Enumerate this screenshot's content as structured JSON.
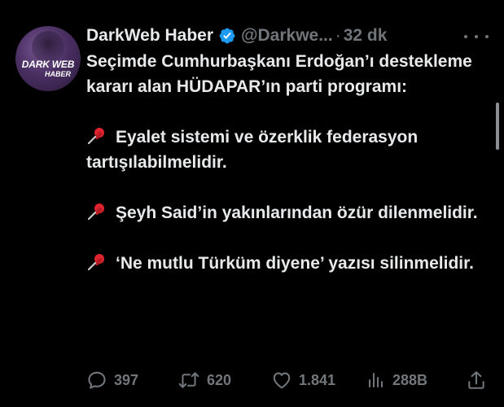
{
  "tweet": {
    "author": {
      "name": "DarkWeb Haber",
      "handle": "@Darkwe...",
      "verified": true,
      "avatar_logo_line1": "DARK WEB",
      "avatar_logo_line2": "HABER"
    },
    "separator": "·",
    "time": "32 dk",
    "text": {
      "intro": "Seçimde Cumhurbaşkanı Erdoğan’ı destekleme kararı alan HÜDAPAR’ın parti programı:",
      "items": [
        "Eyalet sistemi ve özerklik federasyon tartışılabilmelidir.",
        "Şeyh Said’in yakınlarından özür dilenmelidir.",
        "‘Ne mutlu Türküm diyene’ yazısı silinmelidir."
      ],
      "bullet_icon": "pushpin-icon"
    },
    "actions": {
      "replies": "397",
      "retweets": "620",
      "likes": "1.841",
      "views": "288B"
    }
  },
  "colors": {
    "background": "#000000",
    "text": "#e7e9ea",
    "muted": "#71767b",
    "verified": "#1d9bf0",
    "pin": "#e0242f"
  },
  "icons": [
    "verified-badge-icon",
    "more-icon",
    "pushpin-icon",
    "reply-icon",
    "retweet-icon",
    "like-icon",
    "views-icon",
    "share-icon"
  ]
}
